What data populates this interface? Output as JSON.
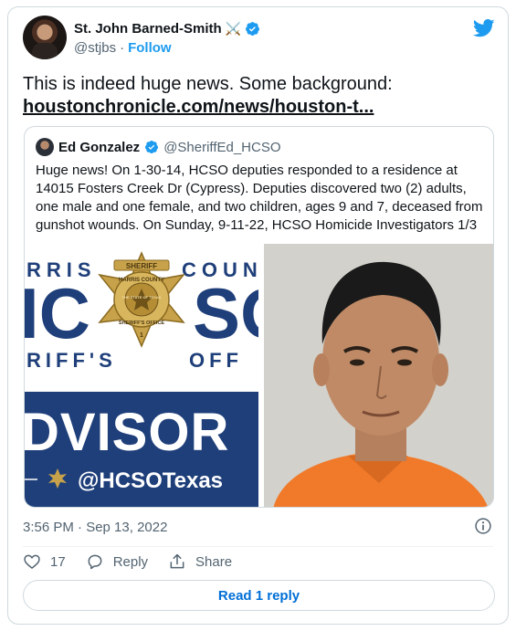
{
  "tweet": {
    "author_name": "St. John Barned-Smith",
    "author_emoji": "⚔️",
    "author_handle": "@stjbs",
    "follow_label": "Follow",
    "text": "This is indeed huge news. Some background:",
    "link_text": "houstonchronicle.com/news/houston-t...",
    "timestamp": "3:56 PM · Sep 13, 2022",
    "likes_count": "17",
    "reply_label": "Reply",
    "share_label": "Share",
    "read_replies_label": "Read 1 reply"
  },
  "quoted": {
    "author_name": "Ed Gonzalez",
    "author_handle": "@SheriffEd_HCSO",
    "text": "Huge news! On 1-30-14, HCSO deputies responded to a residence at 14015 Fosters Creek Dr (Cypress). Deputies discovered two (2) adults, one male and one female, and two children, ages 9 and 7, deceased from gunshot wounds. On Sunday, 9-11-22, HCSO Homicide Investigators 1/3",
    "graphic": {
      "line1": "RRIS",
      "line1b": "COUN",
      "big_left": "IC",
      "big_right": "SO",
      "line3": "RIFF'S",
      "line3b": "OFF",
      "badge_top": "SHERIFF",
      "badge_ring": "HARRIS COUNTY",
      "badge_state": "THE STATE OF TEXAS",
      "badge_bottom": "SHERIFF'S OFFICE",
      "badge_num": "1",
      "advisory": "DVISOR",
      "social_handle": "@HCSOTexas"
    }
  },
  "colors": {
    "accent": "#1d9bf0",
    "link_blue": "#006fd6",
    "navy": "#1f3f7a",
    "gold": "#c8a24a",
    "mugshot_shirt": "#f07a2a"
  }
}
